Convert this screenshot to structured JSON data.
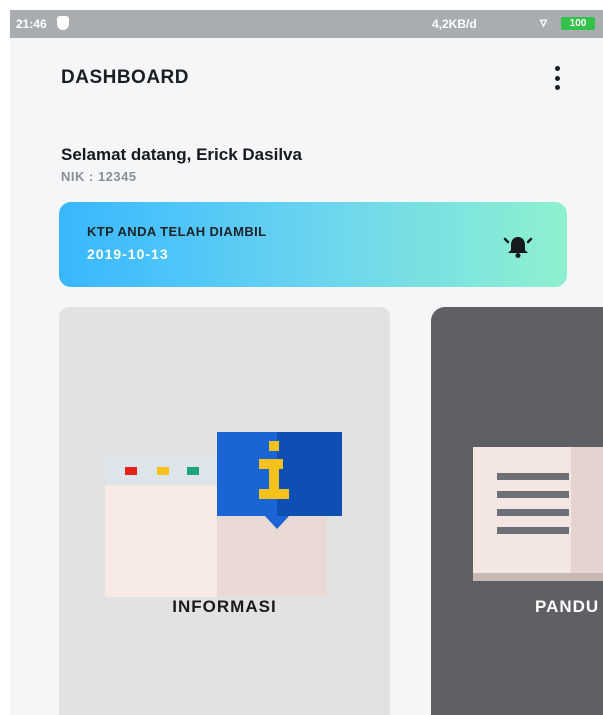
{
  "status_bar": {
    "time": "21:46",
    "network_speed": "4,2KB/d",
    "battery": "100"
  },
  "header": {
    "title": "DASHBOARD",
    "menu_icon": "more-vertical-icon"
  },
  "welcome": {
    "greeting": "Selamat datang, Erick Dasilva",
    "nik": "NIK : 12345"
  },
  "notification": {
    "title": "KTP ANDA TELAH DIAMBIL",
    "date": "2019-10-13",
    "icon": "alarm-bell-icon",
    "gradient": [
      "#38b7ff",
      "#8ff0cf"
    ]
  },
  "menu_cards": [
    {
      "label": "INFORMASI",
      "icon": "information-icon",
      "background": "#e1e2e3"
    },
    {
      "label": "PANDU",
      "icon": "guide-book-icon",
      "background": "#5e6066"
    }
  ]
}
